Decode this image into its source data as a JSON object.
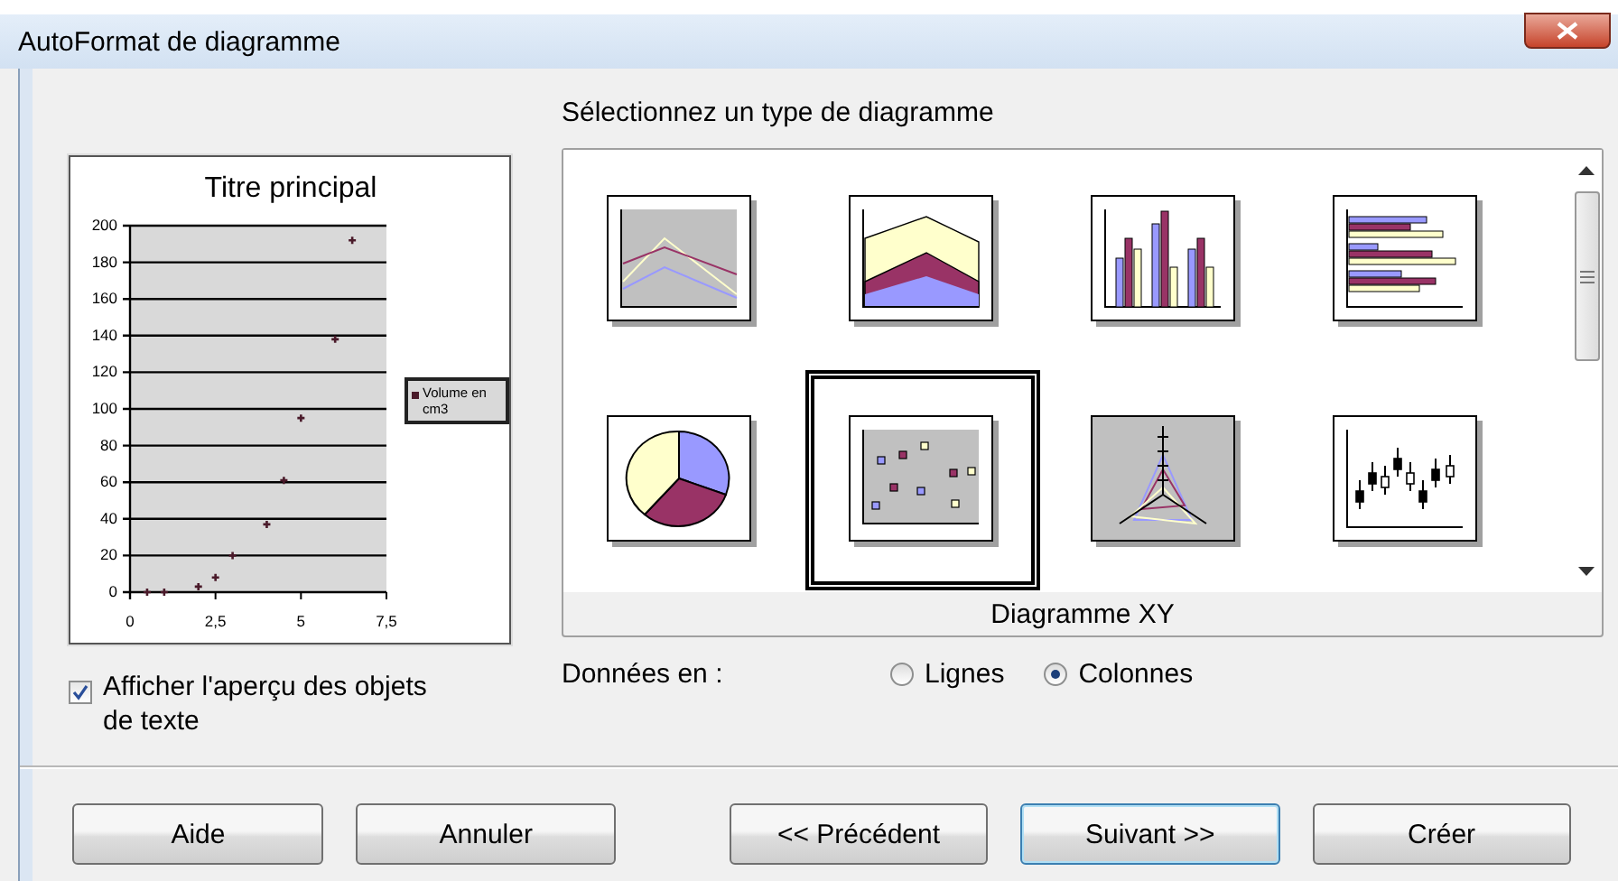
{
  "window": {
    "title": "AutoFormat de diagramme"
  },
  "preview": {
    "chart_data": {
      "type": "scatter",
      "title": "Titre principal",
      "x": [
        0.5,
        1,
        2,
        2.5,
        3,
        4,
        4.5,
        5,
        6,
        6.5
      ],
      "series": [
        {
          "name": "Volume en cm3",
          "color": "#4a1a2a",
          "values": [
            0,
            0,
            3,
            8,
            20,
            37,
            61,
            95,
            138,
            192
          ]
        }
      ],
      "grid": true,
      "xlim": [
        0,
        7.5
      ],
      "ylim": [
        0,
        200
      ],
      "xticks": [
        0,
        {
          "value": 2.5,
          "label": "2,5"
        },
        5,
        {
          "value": 7.5,
          "label": "7,5"
        }
      ],
      "yticks": [
        0,
        20,
        40,
        60,
        80,
        100,
        120,
        140,
        160,
        180,
        200
      ]
    }
  },
  "show_text_objects": {
    "label": "Afficher l'aperçu des objets de texte",
    "checked": true
  },
  "chart_type_heading": "Sélectionnez un type de diagramme",
  "chart_types": [
    {
      "kind": "line",
      "selected": false
    },
    {
      "kind": "area",
      "selected": false
    },
    {
      "kind": "column",
      "selected": false
    },
    {
      "kind": "bar",
      "selected": false
    },
    {
      "kind": "pie",
      "selected": false
    },
    {
      "kind": "xy",
      "selected": true
    },
    {
      "kind": "net",
      "selected": false
    },
    {
      "kind": "stock",
      "selected": false
    }
  ],
  "selected_type_label": "Diagramme XY",
  "data_in": {
    "label": "Données en :",
    "options": [
      {
        "label": "Lignes",
        "selected": false
      },
      {
        "label": "Colonnes",
        "selected": true
      }
    ]
  },
  "buttons": [
    {
      "label": "Aide",
      "default": false
    },
    {
      "label": "Annuler",
      "default": false
    },
    {
      "label": "<< Précédent",
      "default": false
    },
    {
      "label": "Suivant >>",
      "default": true
    },
    {
      "label": "Créer",
      "default": false
    }
  ]
}
